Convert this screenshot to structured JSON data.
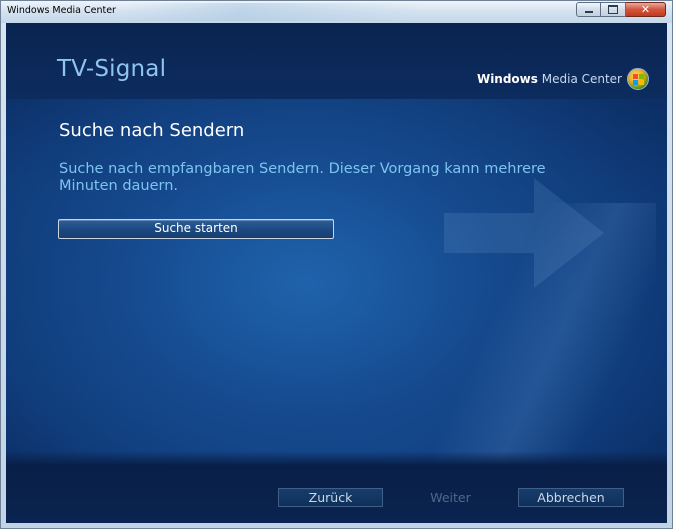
{
  "window": {
    "title": "Windows Media Center",
    "controls": {
      "minimize": "minimize-icon",
      "maximize": "maximize-icon",
      "close": "close-icon"
    }
  },
  "header": {
    "page_title": "TV-Signal",
    "brand_bold": "Windows",
    "brand_light": "Media Center",
    "brand_logo": "windows-logo-icon"
  },
  "main": {
    "heading": "Suche nach Sendern",
    "description": "Suche nach empfangbaren Sendern. Dieser Vorgang kann mehrere Minuten dauern.",
    "search_button": "Suche starten"
  },
  "footer": {
    "back": "Zurück",
    "next": "Weiter",
    "cancel": "Abbrechen"
  },
  "colors": {
    "title": "#8fc4ee",
    "description": "#7ec4f0",
    "background": "#0d3570",
    "disabled_text": "#4c6a8e"
  }
}
